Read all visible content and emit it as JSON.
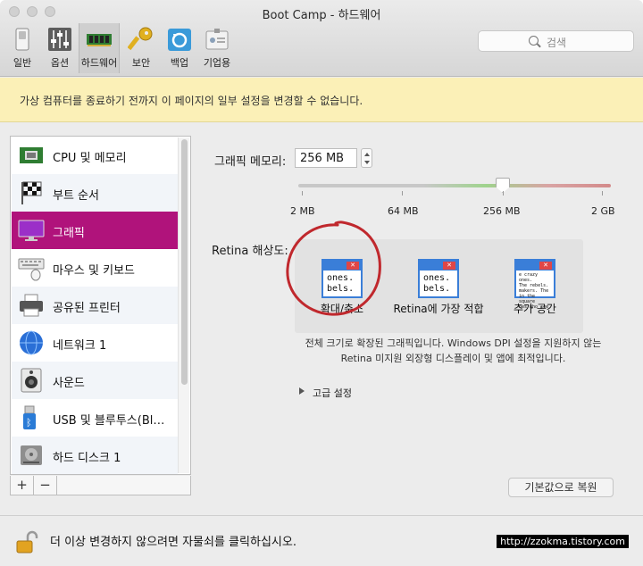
{
  "window": {
    "title": "Boot Camp - 하드웨어"
  },
  "toolbar": {
    "items": [
      {
        "label": "일반",
        "icon": "general-switch-icon"
      },
      {
        "label": "옵션",
        "icon": "options-sliders-icon"
      },
      {
        "label": "하드웨어",
        "icon": "memory-chip-icon",
        "active": true
      },
      {
        "label": "보안",
        "icon": "key-icon"
      },
      {
        "label": "백업",
        "icon": "backup-icon"
      },
      {
        "label": "기업용",
        "icon": "enterprise-badge-icon"
      }
    ],
    "search_placeholder": "검색"
  },
  "banner": {
    "text": "가상 컴퓨터를 종료하기 전까지 이 페이지의 일부 설정을 변경할 수 없습니다."
  },
  "sidebar": {
    "items": [
      {
        "label": "CPU 및 메모리",
        "icon": "cpu-memory-icon"
      },
      {
        "label": "부트 순서",
        "icon": "boot-order-flag-icon"
      },
      {
        "label": "그래픽",
        "icon": "graphics-monitor-icon",
        "selected": true
      },
      {
        "label": "마우스 및 키보드",
        "icon": "mouse-keyboard-icon"
      },
      {
        "label": "공유된 프린터",
        "icon": "printer-icon"
      },
      {
        "label": "네트워크 1",
        "icon": "network-globe-icon"
      },
      {
        "label": "사운드",
        "icon": "speaker-icon"
      },
      {
        "label": "USB 및 블루투스(Bl…",
        "icon": "usb-bluetooth-icon"
      },
      {
        "label": "하드 디스크 1",
        "icon": "hard-disk-icon"
      }
    ],
    "add_label": "+",
    "remove_label": "−"
  },
  "graphics": {
    "memory_label": "그래픽 메모리:",
    "memory_value": "256 MB",
    "slider_ticks": [
      "2 MB",
      "64 MB",
      "256 MB",
      "2 GB"
    ],
    "slider_selected": "256 MB",
    "retina_label": "Retina 해상도:",
    "retina_options": [
      {
        "label": "확대/축소",
        "preview_text": "ones.\nbels.",
        "selected": true
      },
      {
        "label": "Retina에 가장 적합",
        "preview_text": "ones.\nbels."
      },
      {
        "label": "추가 공간",
        "preview_text": "e crazy ones.\nThe rebels.\nmakers. The\nin the square\nnes who see"
      }
    ],
    "description_line1": "전체 크기로 확장된 그래픽입니다. Windows DPI 설정을 지원하지 않는",
    "description_line2": "Retina 미지원 외장형 디스플레이 및 앱에 최적입니다.",
    "advanced_label": "고급 설정",
    "restore_label": "기본값으로 복원"
  },
  "bottom": {
    "lock_text": "더 이상 변경하지 않으려면 자물쇠를 클릭하십시오.",
    "watermark": "http://zzokma.tistory.com"
  },
  "colors": {
    "selection": "#b0137b",
    "banner": "#fbf0b7",
    "annotation": "#c0282d"
  }
}
